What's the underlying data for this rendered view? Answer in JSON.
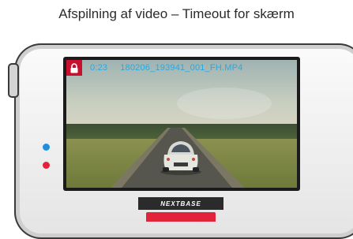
{
  "caption": "Afspilning af video – Timeout for skærm",
  "playback": {
    "elapsed_time": "0:23",
    "filename": "180206_193941_001_FH.MP4",
    "locked": true
  },
  "device": {
    "brand": "NEXTBASE"
  },
  "colors": {
    "status_text": "#2aa8e0",
    "lock_badge": "#c8102e",
    "led_blue": "#1f8fe0",
    "led_red": "#e3233a"
  },
  "icons": {
    "lock": "lock-icon"
  }
}
